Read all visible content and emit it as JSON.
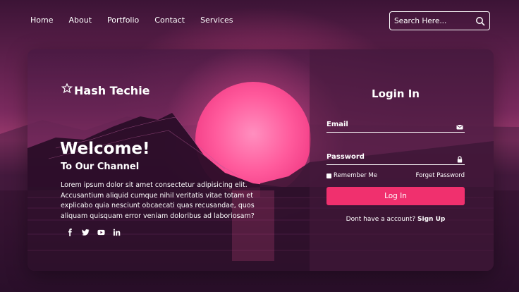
{
  "nav": {
    "items": [
      "Home",
      "About",
      "Portfolio",
      "Contact",
      "Services"
    ]
  },
  "search": {
    "placeholder": "Search Here...",
    "icon": "search-icon"
  },
  "hero": {
    "brand": "Hash Techie",
    "brand_icon": "gear-star-icon",
    "welcome": "Welcome!",
    "subtitle": "To Our Channel",
    "text": "Lorem ipsum dolor sit amet consectetur adipisicing elit. Accusantium aliquid cumque nihil veritatis vitae totam et explicabo quia nesciunt obcaecati quas recusandae, quos aliquam quisquam error veniam doloribus ad laboriosam?",
    "socials": [
      "facebook-icon",
      "twitter-icon",
      "youtube-icon",
      "linkedin-icon"
    ]
  },
  "login": {
    "title": "Login In",
    "email_label": "Email",
    "email_icon": "mail-icon",
    "password_label": "Password",
    "password_icon": "lock-icon",
    "remember": "Remember Me",
    "forgot": "Forget Password",
    "button": "Log In",
    "signup_prompt": "Dont have a account?",
    "signup_link": "Sign Up"
  },
  "colors": {
    "accent": "#f0306e",
    "background": "#3a1630"
  }
}
